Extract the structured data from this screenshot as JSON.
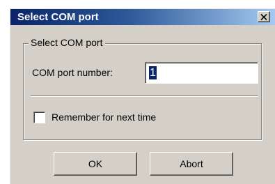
{
  "dialog": {
    "title": "Select COM port",
    "close_icon": "close-icon",
    "titlebar_colors": [
      "#0a246a",
      "#a6caf0"
    ],
    "body_color": "#d4d0c8"
  },
  "group": {
    "legend": "Select COM port",
    "port_label": "COM port number:",
    "port_value": "1",
    "remember_label": "Remember for next time",
    "remember_checked": false
  },
  "buttons": {
    "ok_label": "OK",
    "abort_label": "Abort"
  }
}
